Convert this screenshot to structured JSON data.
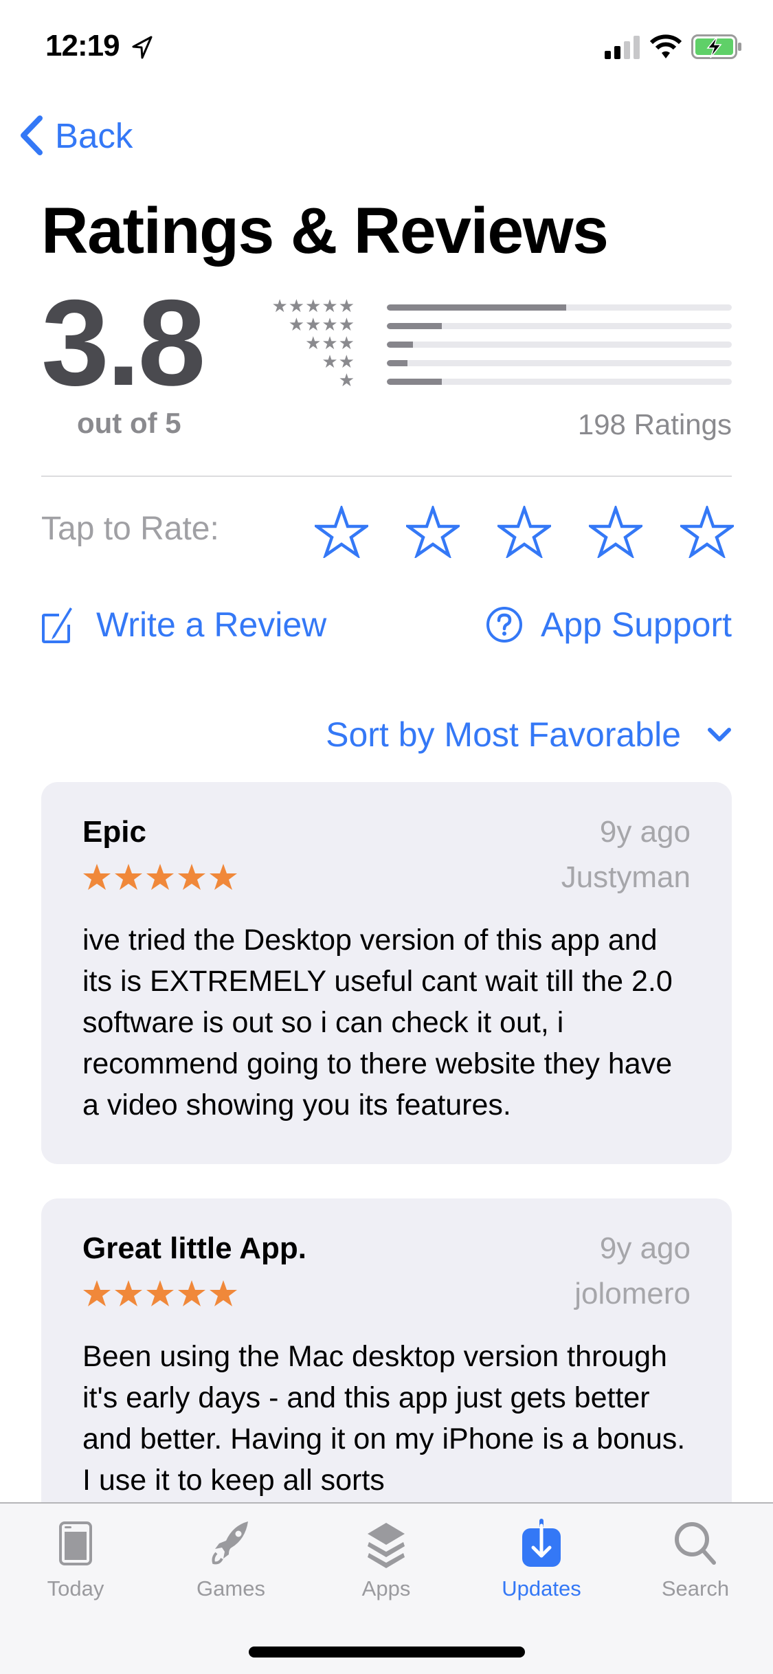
{
  "status_bar": {
    "time": "12:19",
    "location_icon": "location-arrow-icon",
    "signal_icon": "cellular-signal-icon",
    "wifi_icon": "wifi-icon",
    "battery_icon": "battery-charging-icon",
    "battery_color": "#5fd068"
  },
  "nav": {
    "back_label": "Back",
    "back_icon": "chevron-left-icon"
  },
  "page": {
    "title": "Ratings & Reviews"
  },
  "summary": {
    "average": "3.8",
    "out_of": "out of 5",
    "ratings_count": "198 Ratings",
    "distribution": [
      {
        "stars": 5,
        "stars_glyph": "★★★★★",
        "fraction": 0.52
      },
      {
        "stars": 4,
        "stars_glyph": "★★★★",
        "fraction": 0.16
      },
      {
        "stars": 3,
        "stars_glyph": "★★★",
        "fraction": 0.075
      },
      {
        "stars": 2,
        "stars_glyph": "★★",
        "fraction": 0.06
      },
      {
        "stars": 1,
        "stars_glyph": "★",
        "fraction": 0.16
      }
    ]
  },
  "tap_to_rate": {
    "label": "Tap to Rate:",
    "star_count": 5,
    "selected": 0
  },
  "actions": {
    "write_review_label": "Write a Review",
    "write_review_icon": "compose-icon",
    "app_support_label": "App Support",
    "app_support_icon": "question-circle-icon"
  },
  "sort": {
    "label": "Sort by Most Favorable",
    "icon": "chevron-down-icon"
  },
  "reviews": [
    {
      "title": "Epic",
      "date": "9y ago",
      "author": "Justyman",
      "rating": 5,
      "body": "ive tried the Desktop version of this app and its is EXTREMELY useful cant wait till the 2.0 software is out so i can check it out, i recommend going to there website they have a video showing you its features."
    },
    {
      "title": "Great little App.",
      "date": "9y ago",
      "author": "jolomero",
      "rating": 5,
      "body": "Been using the Mac desktop version through it's early days - and this app just gets better and better.  Having it on my iPhone is a bonus.  I use it to keep all sorts"
    }
  ],
  "tab_bar": {
    "tabs": [
      {
        "label": "Today",
        "icon": "today-icon",
        "active": false
      },
      {
        "label": "Games",
        "icon": "rocket-icon",
        "active": false
      },
      {
        "label": "Apps",
        "icon": "apps-stack-icon",
        "active": false
      },
      {
        "label": "Updates",
        "icon": "updates-download-icon",
        "active": true
      },
      {
        "label": "Search",
        "icon": "search-icon",
        "active": false
      }
    ]
  },
  "colors": {
    "accent": "#3478f6",
    "review_star": "#f0883a",
    "bar_fill": "#86858b",
    "bar_track": "#e8e8ec",
    "card_bg": "#efeff5"
  }
}
